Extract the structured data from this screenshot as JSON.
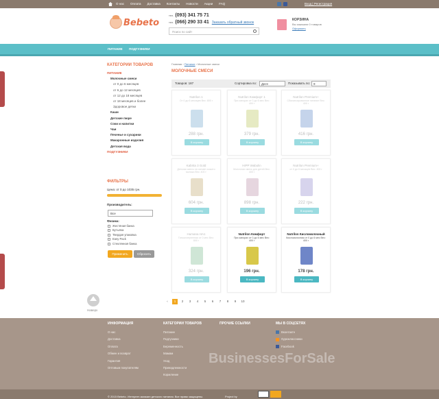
{
  "topbar": {
    "menu": [
      "О нас",
      "Оплата",
      "Доставка",
      "Контакты",
      "Новости",
      "Акции",
      "FAQ"
    ],
    "login": "Вход | Регистрация"
  },
  "header": {
    "logo": "Bebeto",
    "phone_label1": "тел.",
    "phone1": "(093) 341 75 71",
    "phone_label2": "тел.",
    "phone2": "(066) 290 33 41",
    "callback": "Заказать обратный звонок",
    "search_placeholder": "Поиск по сайт"
  },
  "cart": {
    "title": "КОРЗИНА",
    "subtitle": "Вы заказали 0 товаров",
    "checkout": "Оформить"
  },
  "nav": [
    "ПИТАНИЕ",
    "ПОДГУЗНИКИ"
  ],
  "side_tabs": [
    "Помощь",
    "Помощь"
  ],
  "categories": {
    "title": "КАТЕГОРИИ ТОВАРОВ",
    "items": [
      {
        "t": "ПИТАНИЕ",
        "c": "red"
      },
      {
        "t": "Молочные смеси",
        "c": "i1"
      },
      {
        "t": "от 0 до 6 месяцев",
        "c": "i2"
      },
      {
        "t": "от 6 до 12 месяцев",
        "c": "i2"
      },
      {
        "t": "от 12 до 18 месяцев",
        "c": "i2"
      },
      {
        "t": "от 18 месяцев и более",
        "c": "i2"
      },
      {
        "t": "Здоровое детки",
        "c": "i2"
      },
      {
        "t": "Каши",
        "c": "i1"
      },
      {
        "t": "Детские пюре",
        "c": "i1"
      },
      {
        "t": "Соки и напитки",
        "c": "i1"
      },
      {
        "t": "Чаи",
        "c": "i1"
      },
      {
        "t": "Печенье и сухарики",
        "c": "i1"
      },
      {
        "t": "Макаронные изделия",
        "c": "i1"
      },
      {
        "t": "Детская вода",
        "c": "i1"
      },
      {
        "t": "ПОДГУЗНИКИ",
        "c": "red"
      }
    ]
  },
  "filters": {
    "title": "ФИЛЬТРЫ",
    "price": "Цена: от 0 до 1035 грн.",
    "manufacturer_label": "Производитель:",
    "manufacturer_value": "Все",
    "physical_label": "Физика:",
    "options": [
      "Жестяная банка",
      "Бутылка",
      "Твердая упаковка",
      "Easy Pack",
      "Стеклянная банка"
    ],
    "apply": "Применить",
    "reset": "Сбросить"
  },
  "up": "Наверх",
  "breadcrumbs": {
    "home": "Главная",
    "cat": "Питание",
    "current": "Молочные смеси"
  },
  "page_title": "МОЛОЧНЫЕ СМЕСИ",
  "sortbar": {
    "count": "Товаров: 187",
    "sort_label": "Сортировка по:",
    "sort_value": "Дате",
    "per_page_label": "Показывать по:",
    "per_page_value": "9"
  },
  "products": [
    {
      "name": "Nutrilon 1",
      "desc": "От 0 до 6 месяцев  Вес: 800 г",
      "price": "288 грн.",
      "btn": "В корзину",
      "dark": false,
      "color": "#8fb8d8"
    },
    {
      "name": "Nutrilon Комфорт 1",
      "desc": "При запорах от 0 до 6 мес  Вес: 400 г",
      "price": "379 грн.",
      "btn": "В корзину",
      "dark": false,
      "color": "#c8d07a"
    },
    {
      "name": "Nutrilon Premium+",
      "desc": "Сбалансированное питание  Вес: 400 г",
      "price": "416 грн.",
      "btn": "В корзину",
      "dark": false,
      "color": "#7f9fd2"
    },
    {
      "name": "Kabrita 3 Gold",
      "desc": "Детская смесь на основе козьего молока  Вес: 400 г",
      "price": "604 грн.",
      "btn": "В корзину",
      "dark": false,
      "color": "#ccb88a"
    },
    {
      "name": "HiPP Wabolin",
      "desc": "Молочная смесь для детей  Вес: 400 г",
      "price": "898 грн.",
      "btn": "В корзину",
      "dark": false,
      "color": "#c7a4b8"
    },
    {
      "name": "Nutrilon Premium+",
      "desc": "от 0 до 6 месяцев  Вес: 400 г",
      "price": "222 грн.",
      "btn": "В корзину",
      "dark": false,
      "color": "#a7a0d8"
    },
    {
      "name": "Humana HA1",
      "desc": "Гипоаллергенная от 0 мес  Вес: 800 г",
      "price": "324 грн.",
      "btn": "В корзину",
      "dark": false,
      "color": "#94c8a4"
    },
    {
      "name": "Nutrilon Комфорт",
      "desc": "При запорах от 0 до 6 мес  Вес: 400 г",
      "price": "196 грн.",
      "btn": "В корзину",
      "dark": true,
      "color": "#d8c84a"
    },
    {
      "name": "Nutrilon Кисломолочный",
      "desc": "Кисломолочная от 0 до 6 мес  Вес: 400 г",
      "price": "178 грн.",
      "btn": "В корзину",
      "dark": true,
      "color": "#6f86c8"
    }
  ],
  "pager": [
    "1",
    "2",
    "3",
    "4",
    "5",
    "6",
    "7",
    "8",
    "9",
    "10"
  ],
  "footer": {
    "info": {
      "title": "ИНФОРМАЦИЯ",
      "items": [
        "О нас",
        "Доставка",
        "Оплата",
        "Обмен и возврат",
        "Гарантия",
        "Оптовым покупателям"
      ]
    },
    "cats": {
      "title": "КАТЕГОРИИ ТОВАРОВ",
      "items": [
        "Питание",
        "Подгузники",
        "Беременность",
        "Мамам",
        "Уход",
        "Принадлежности",
        "Кормление"
      ]
    },
    "other": {
      "title": "ПРОЧИЕ ССЫЛКИ"
    },
    "social": {
      "title": "МЫ В СОЦСЕТЯХ",
      "items": [
        "Вконтакте",
        "Одноклассники",
        "Facebook"
      ]
    },
    "watermark": "BusinessesForSale"
  },
  "bottom": {
    "copy": "© 2015 Bebeto. Интернет-магазин детского питания. Все права защищены.",
    "project": "Project by"
  }
}
